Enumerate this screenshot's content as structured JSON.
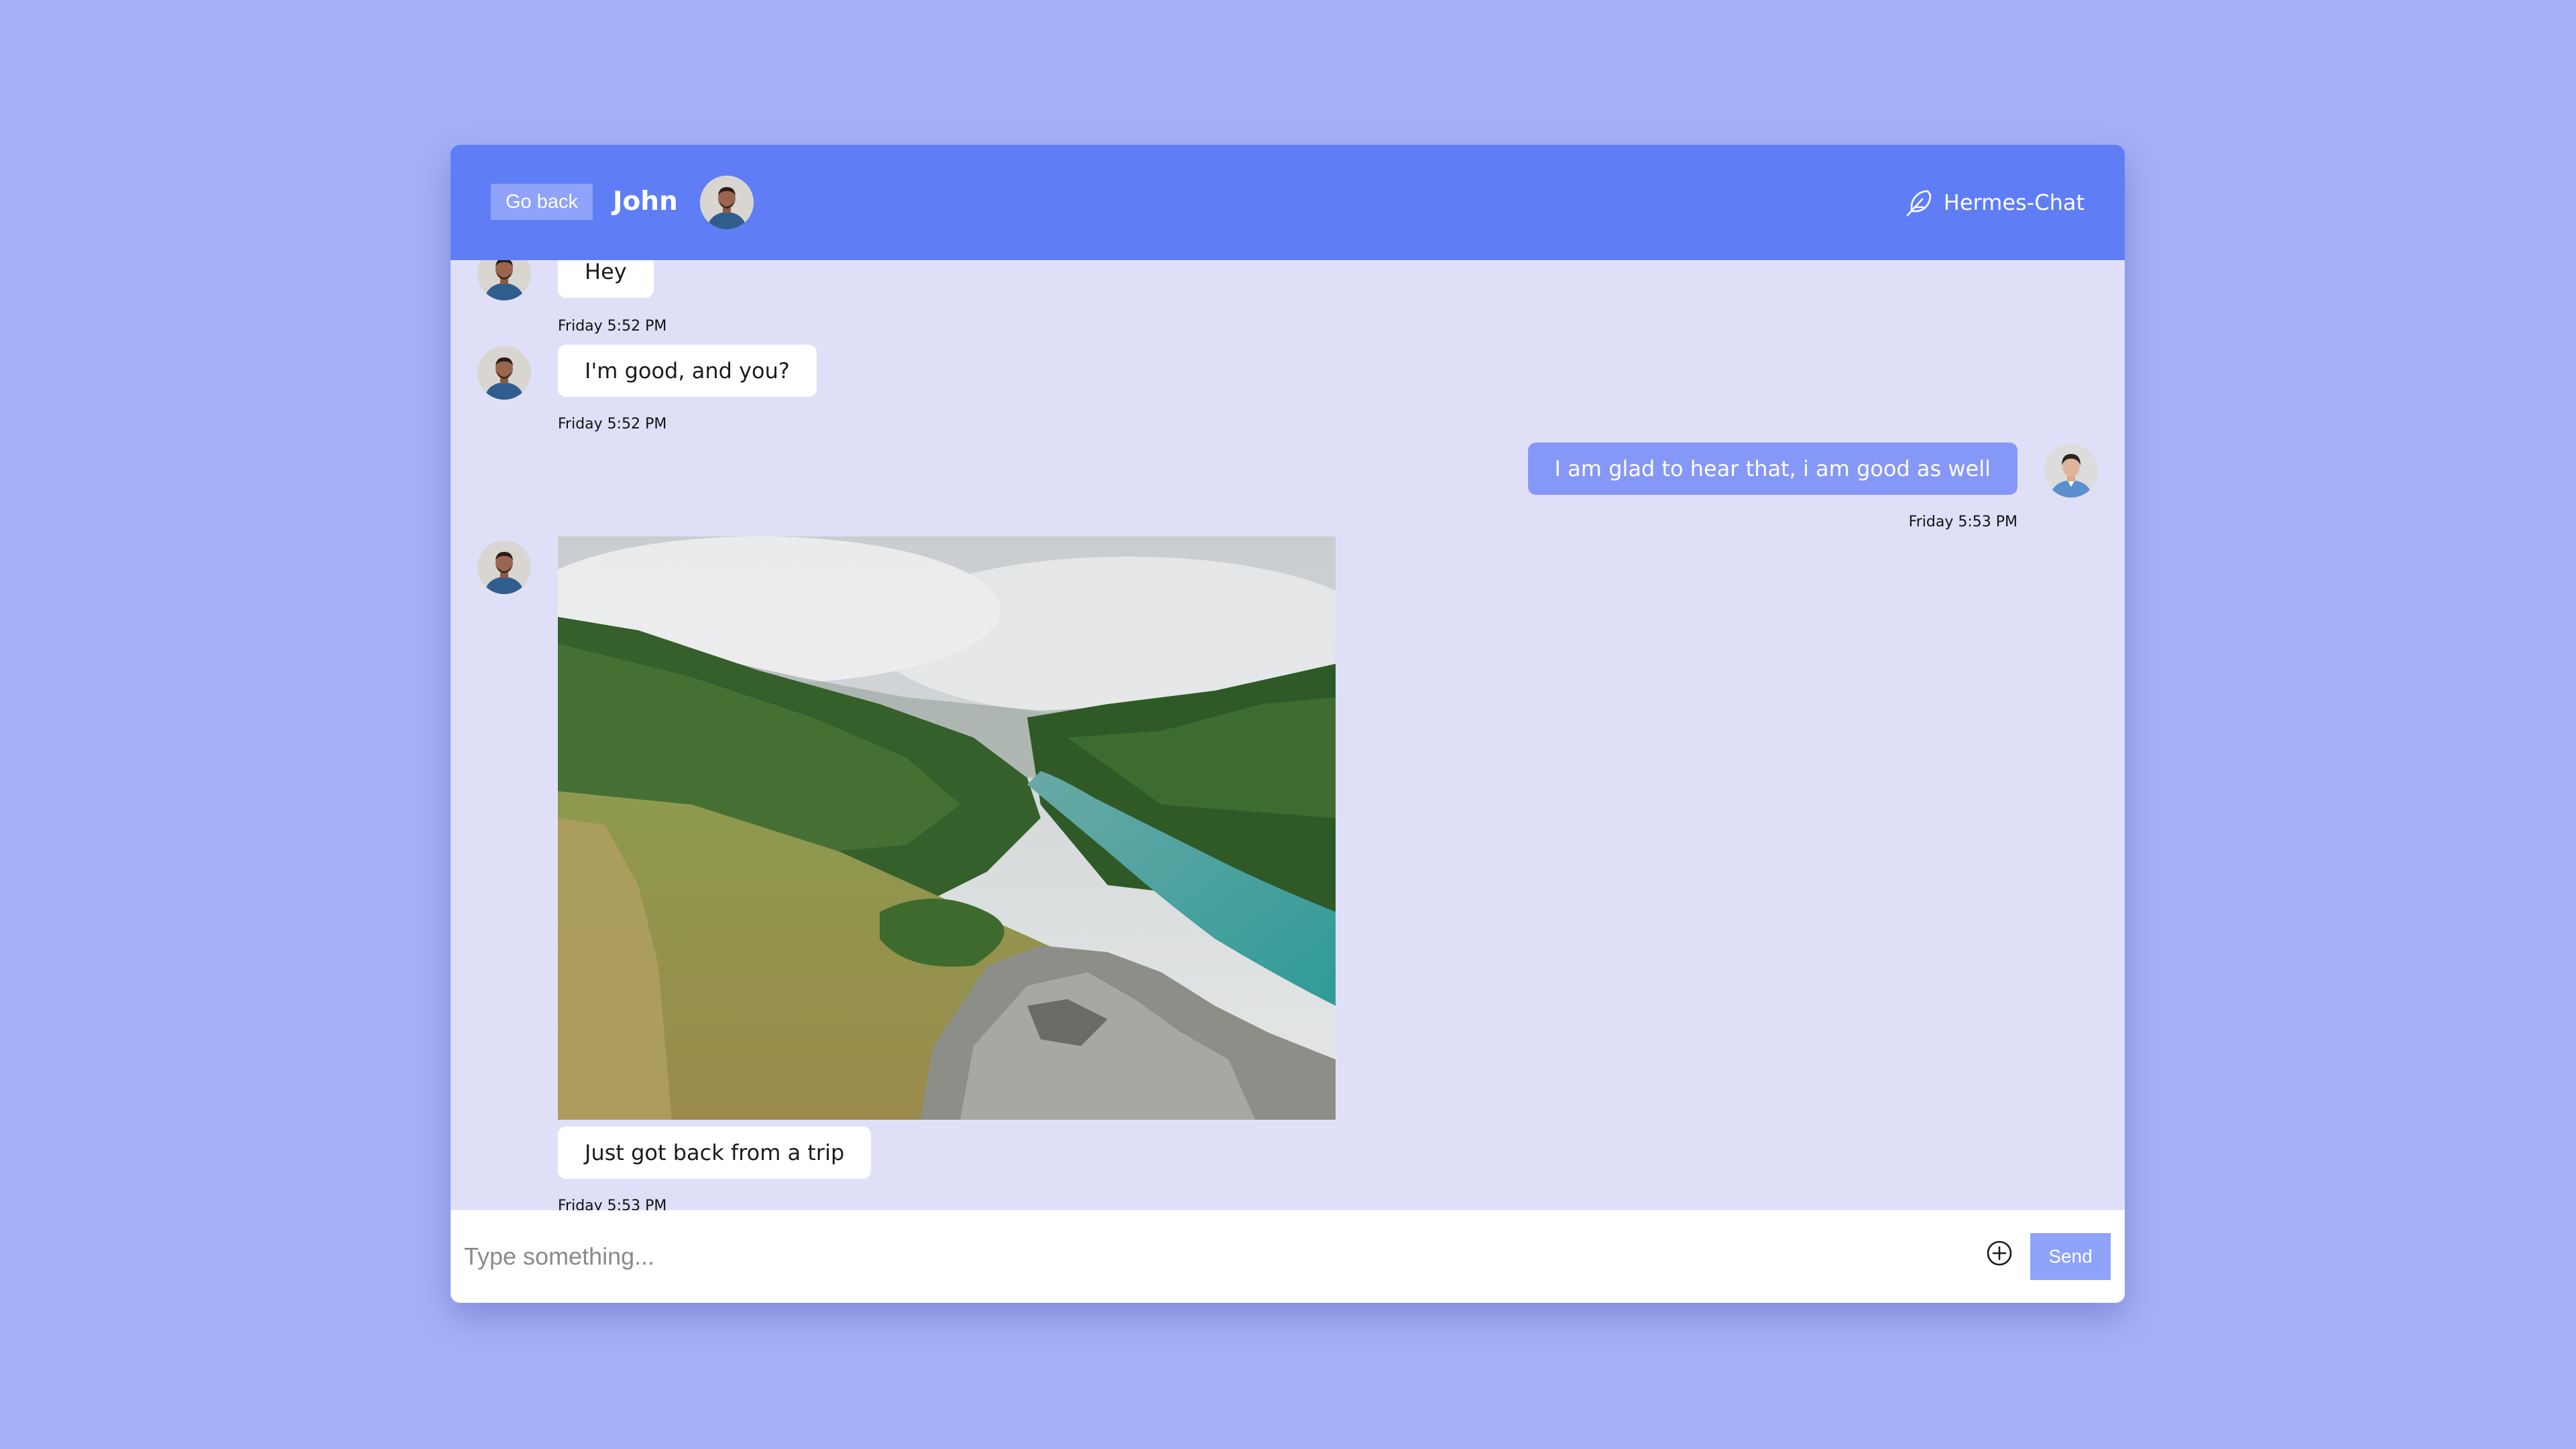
{
  "header": {
    "back_label": "Go back",
    "contact_name": "John",
    "brand_name": "Hermes-Chat",
    "brand_icon": "feather-icon"
  },
  "messages": [
    {
      "direction": "incoming",
      "text": "Hey",
      "time": "Friday 5:52 PM"
    },
    {
      "direction": "incoming",
      "text": "I'm good, and you?",
      "time": "Friday 5:52 PM"
    },
    {
      "direction": "outgoing",
      "text": "I am glad to hear that, i am good as well",
      "time": "Friday 5:53 PM"
    },
    {
      "direction": "incoming",
      "image": "landscape-photo",
      "text": "Just got back from a trip",
      "time": "Friday 5:53 PM"
    }
  ],
  "composer": {
    "placeholder": "Type something...",
    "send_label": "Send",
    "attach_icon": "plus-circle-icon"
  },
  "colors": {
    "background": "#a4b1f8",
    "header": "#5f7ef6",
    "chat_area": "#dfe0f8",
    "outgoing_bubble": "#8698f7",
    "button": "#8fa3fa"
  }
}
